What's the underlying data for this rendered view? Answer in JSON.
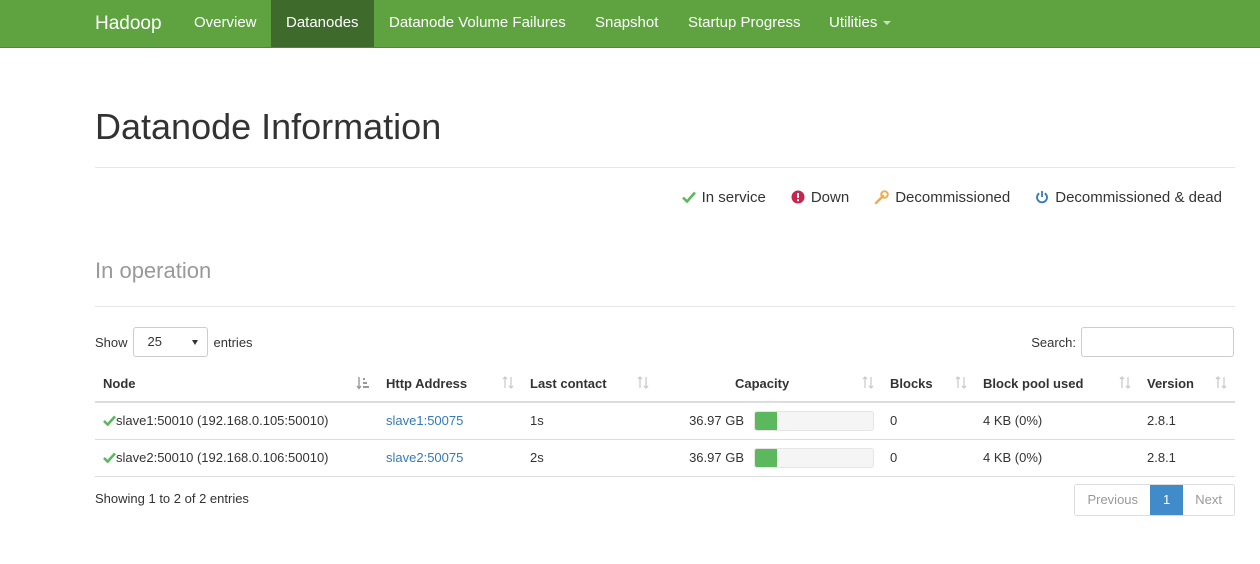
{
  "navbar": {
    "brand": "Hadoop",
    "items": [
      {
        "label": "Overview"
      },
      {
        "label": "Datanodes"
      },
      {
        "label": "Datanode Volume Failures"
      },
      {
        "label": "Snapshot"
      },
      {
        "label": "Startup Progress"
      },
      {
        "label": "Utilities"
      }
    ]
  },
  "page": {
    "title": "Datanode Information",
    "section_title": "In operation"
  },
  "legend": {
    "in_service": "In service",
    "down": "Down",
    "decommissioned": "Decommissioned",
    "decommissioned_dead": "Decommissioned & dead"
  },
  "table_controls": {
    "show_label": "Show",
    "entries_value": "25",
    "entries_label": "entries",
    "search_label": "Search:",
    "search_value": ""
  },
  "table": {
    "columns": [
      "Node",
      "Http Address",
      "Last contact",
      "Capacity",
      "Blocks",
      "Block pool used",
      "Version"
    ],
    "rows": [
      {
        "node": "slave1:50010 (192.168.0.105:50010)",
        "http": "slave1:50075",
        "last_contact": "1s",
        "capacity": "36.97 GB",
        "capacity_used_fraction": 0.19,
        "blocks": "0",
        "block_pool_used": "4 KB (0%)",
        "version": "2.8.1"
      },
      {
        "node": "slave2:50010 (192.168.0.106:50010)",
        "http": "slave2:50075",
        "last_contact": "2s",
        "capacity": "36.97 GB",
        "capacity_used_fraction": 0.19,
        "blocks": "0",
        "block_pool_used": "4 KB (0%)",
        "version": "2.8.1"
      }
    ]
  },
  "footer": {
    "info": "Showing 1 to 2 of 2 entries",
    "previous": "Previous",
    "current_page": "1",
    "next": "Next"
  },
  "colors": {
    "navbar": "#5fa341",
    "navbar_active": "#3e6b2b",
    "in_service": "#5cb85c",
    "down": "#c7254e",
    "decommissioned": "#f0ad4e",
    "decommissioned_dead": "#337ab7",
    "pagination_active": "#428bca"
  }
}
